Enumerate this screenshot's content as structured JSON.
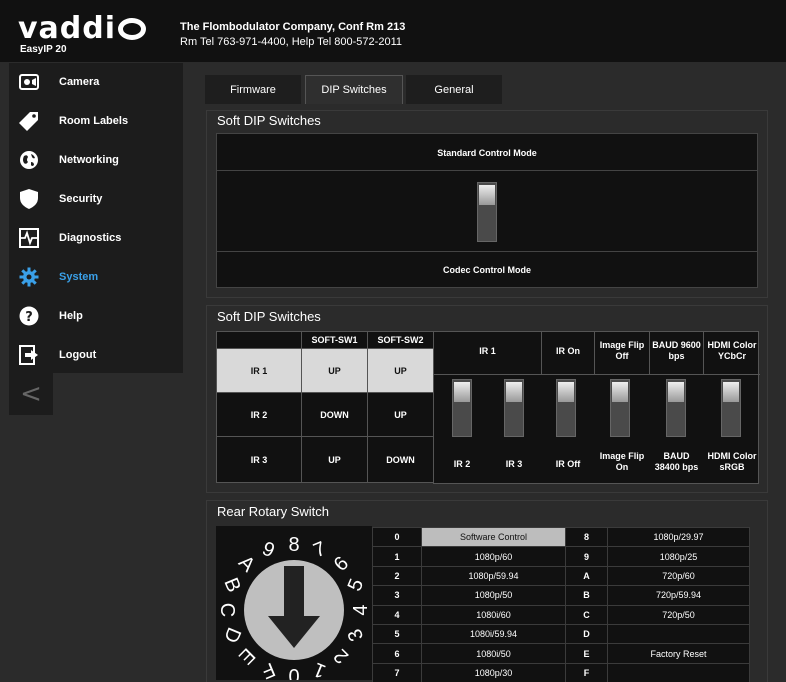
{
  "header": {
    "brand": "vaddi",
    "model": "EasyIP 20",
    "company": "The Flombodulator Company, Conf Rm 213",
    "phones": "Rm Tel 763-971-4400, Help Tel 800-572-2011"
  },
  "sidebar": {
    "items": [
      {
        "label": "Camera",
        "icon": "camera-icon"
      },
      {
        "label": "Room Labels",
        "icon": "tag-icon"
      },
      {
        "label": "Networking",
        "icon": "globe-icon"
      },
      {
        "label": "Security",
        "icon": "shield-icon"
      },
      {
        "label": "Diagnostics",
        "icon": "pulse-icon"
      },
      {
        "label": "System",
        "icon": "gear-icon",
        "active": true
      },
      {
        "label": "Help",
        "icon": "question-icon"
      },
      {
        "label": "Logout",
        "icon": "logout-icon"
      }
    ],
    "collapse": "<"
  },
  "tabs": [
    {
      "label": "Firmware"
    },
    {
      "label": "DIP Switches",
      "active": true
    },
    {
      "label": "General"
    }
  ],
  "soft_dip_1": {
    "title": "Soft DIP Switches",
    "top_label": "Standard Control Mode",
    "bottom_label": "Codec Control Mode",
    "switch_position": "up"
  },
  "soft_dip_2": {
    "title": "Soft DIP Switches",
    "table": {
      "headers": [
        "",
        "SOFT-SW1",
        "SOFT-SW2"
      ],
      "rows": [
        [
          "IR 1",
          "UP",
          "UP"
        ],
        [
          "IR 2",
          "DOWN",
          "UP"
        ],
        [
          "IR 3",
          "UP",
          "DOWN"
        ]
      ]
    },
    "switches_top": [
      "IR 1",
      "IR On",
      "Image Flip Off",
      "BAUD 9600 bps",
      "HDMI Color YCbCr"
    ],
    "switches_bottom": [
      "IR 2",
      "IR 3",
      "IR Off",
      "Image Flip On",
      "BAUD 38400 bps",
      "HDMI Color sRGB"
    ],
    "switch_positions": [
      "up",
      "up",
      "up",
      "up",
      "up",
      "up"
    ]
  },
  "rotary": {
    "title": "Rear Rotary Switch",
    "dial_digits": [
      "0",
      "1",
      "2",
      "3",
      "4",
      "5",
      "6",
      "7",
      "8",
      "9",
      "A",
      "B",
      "C",
      "D",
      "E",
      "F"
    ],
    "rows": [
      [
        "0",
        "Software Control",
        "8",
        "1080p/29.97"
      ],
      [
        "1",
        "1080p/60",
        "9",
        "1080p/25"
      ],
      [
        "2",
        "1080p/59.94",
        "A",
        "720p/60"
      ],
      [
        "3",
        "1080p/50",
        "B",
        "720p/59.94"
      ],
      [
        "4",
        "1080i/60",
        "C",
        "720p/50"
      ],
      [
        "5",
        "1080i/59.94",
        "D",
        ""
      ],
      [
        "6",
        "1080i/50",
        "E",
        "Factory Reset"
      ],
      [
        "7",
        "1080p/30",
        "F",
        ""
      ]
    ],
    "selected_row": 0
  },
  "colors": {
    "accent": "#3aa0e8",
    "background": "#2b2b2b",
    "panel_dark": "#111111",
    "highlight": "#d9d9d9"
  }
}
